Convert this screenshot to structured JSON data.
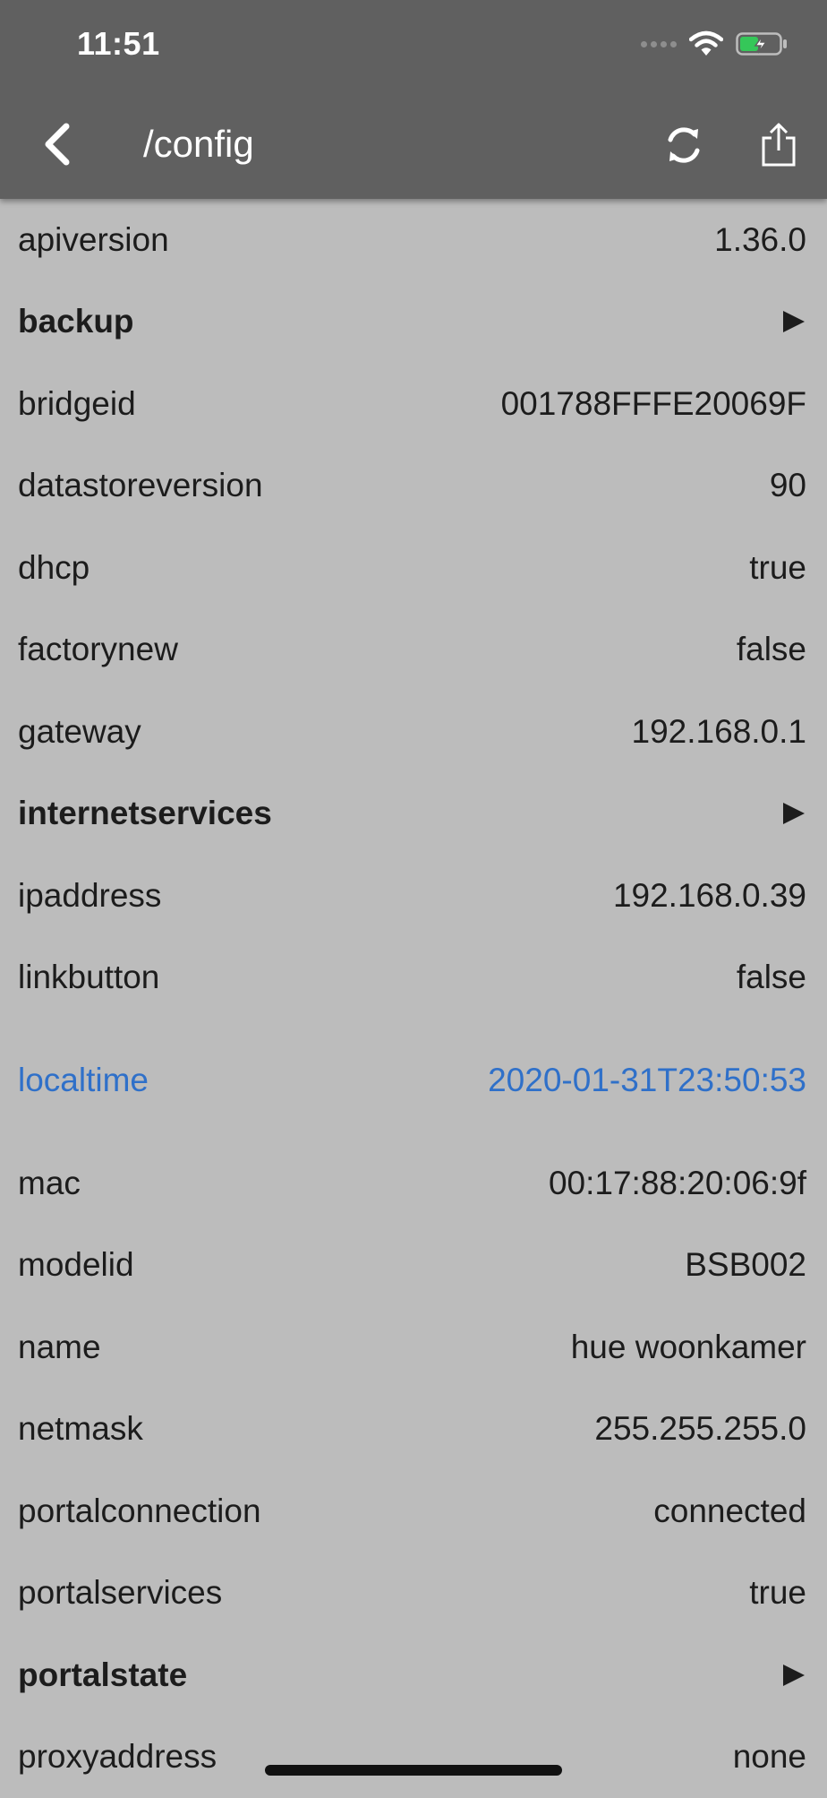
{
  "status_bar": {
    "time": "11:51"
  },
  "nav": {
    "title": "/config",
    "back_icon": "chevron-left-icon",
    "refresh_icon": "refresh-icon",
    "share_icon": "share-icon"
  },
  "colors": {
    "header_bg": "#606060",
    "body_bg": "#bcbcbc",
    "link": "#2f70c9",
    "battery_charge": "#35c759"
  },
  "rows": [
    {
      "key": "apiversion",
      "value": "1.36.0"
    },
    {
      "key": "backup",
      "value": ""
    },
    {
      "key": "bridgeid",
      "value": "001788FFFE20069F"
    },
    {
      "key": "datastoreversion",
      "value": "90"
    },
    {
      "key": "dhcp",
      "value": "true"
    },
    {
      "key": "factorynew",
      "value": "false"
    },
    {
      "key": "gateway",
      "value": "192.168.0.1"
    },
    {
      "key": "internetservices",
      "value": ""
    },
    {
      "key": "ipaddress",
      "value": "192.168.0.39"
    },
    {
      "key": "linkbutton",
      "value": "false"
    },
    {
      "key": "localtime",
      "value": "2020-01-31T23:50:53"
    },
    {
      "key": "mac",
      "value": "00:17:88:20:06:9f"
    },
    {
      "key": "modelid",
      "value": "BSB002"
    },
    {
      "key": "name",
      "value": "hue woonkamer"
    },
    {
      "key": "netmask",
      "value": "255.255.255.0"
    },
    {
      "key": "portalconnection",
      "value": "connected"
    },
    {
      "key": "portalservices",
      "value": "true"
    },
    {
      "key": "portalstate",
      "value": ""
    },
    {
      "key": "proxyaddress",
      "value": "none"
    }
  ]
}
